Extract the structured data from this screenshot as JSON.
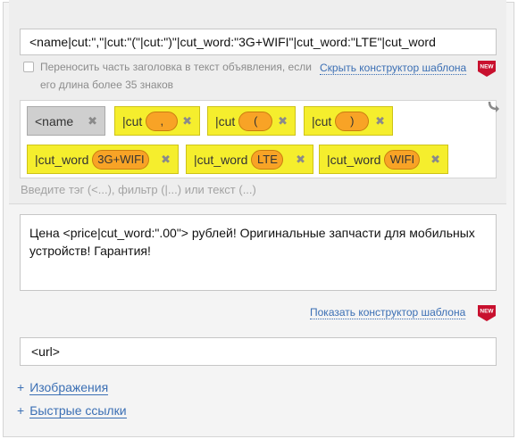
{
  "title_template": {
    "value": "<name|cut:\",\"|cut:\"(\"|cut:\")\"|cut_word:\"3G+WIFI\"|cut_word:\"LTE\"|cut_word",
    "checkbox_label": "Переносить часть заголовка в текст объявления, если его длина более 35 знаков",
    "constructor_link": "Скрыть конструктор шаблона",
    "new_badge": "NEW"
  },
  "tags": [
    {
      "label": "<name",
      "style": "gray"
    },
    {
      "label": "|cut",
      "pill": ",",
      "style": "yellow"
    },
    {
      "label": "|cut",
      "pill": "(",
      "style": "yellow"
    },
    {
      "label": "|cut",
      "pill": ")",
      "style": "yellow"
    },
    {
      "label": "|cut_word",
      "pill": "3G+WIFI",
      "style": "yellow"
    },
    {
      "label": "|cut_word",
      "pill": "LTE",
      "style": "yellow"
    },
    {
      "label": "|cut_word",
      "pill": "WIFI",
      "style": "yellow"
    }
  ],
  "tag_input_hint": "Введите тэг (<...), фильтр (|...) или текст (...)",
  "description": {
    "value": "Цена <price|cut_word:\".00\"> рублей! Оригинальные запчасти для мобильных устройств! Гарантия!",
    "constructor_link": "Показать конструктор шаблона",
    "new_badge": "NEW"
  },
  "url": {
    "value": "<url>"
  },
  "expanders": [
    {
      "plus": "+",
      "label": "Изображения"
    },
    {
      "plus": "+",
      "label": "Быстрые ссылки"
    }
  ],
  "colors": {
    "tag_yellow": "#f5ee2d",
    "pill_orange": "#f8a326",
    "tag_gray": "#cfcfcf",
    "link_blue": "#3b6fb4",
    "badge_red": "#c8102e"
  },
  "icons": {
    "remove": "remove-x-icon",
    "arrow": "curved-arrow-icon",
    "new": "new-badge-icon"
  }
}
